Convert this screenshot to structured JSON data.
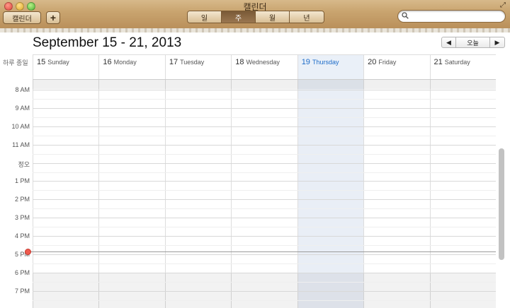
{
  "window": {
    "title": "캘린더"
  },
  "toolbar": {
    "calendars_label": "캘린더",
    "add_label": "+",
    "view_tabs": [
      {
        "label": "일",
        "active": false
      },
      {
        "label": "주",
        "active": true
      },
      {
        "label": "월",
        "active": false
      },
      {
        "label": "년",
        "active": false
      }
    ],
    "search_placeholder": ""
  },
  "header": {
    "range_title": "September 15 - 21, 2013",
    "today_label": "오늘",
    "prev_icon": "◀",
    "next_icon": "▶"
  },
  "all_day_label": "하루 종일",
  "days": [
    {
      "num": "15",
      "name": "Sunday",
      "today": false
    },
    {
      "num": "16",
      "name": "Monday",
      "today": false
    },
    {
      "num": "17",
      "name": "Tuesday",
      "today": false
    },
    {
      "num": "18",
      "name": "Wednesday",
      "today": false
    },
    {
      "num": "19",
      "name": "Thursday",
      "today": true
    },
    {
      "num": "20",
      "name": "Friday",
      "today": false
    },
    {
      "num": "21",
      "name": "Saturday",
      "today": false
    }
  ],
  "hours": [
    "8 AM",
    "9 AM",
    "10 AM",
    "11 AM",
    "정오",
    "1 PM",
    "2 PM",
    "3 PM",
    "4 PM",
    "5 PM",
    "6 PM",
    "7 PM"
  ],
  "colors": {
    "today_accent": "#1c6bc8",
    "now_indicator": "#f05b4f",
    "leather": "#c9a46f"
  }
}
